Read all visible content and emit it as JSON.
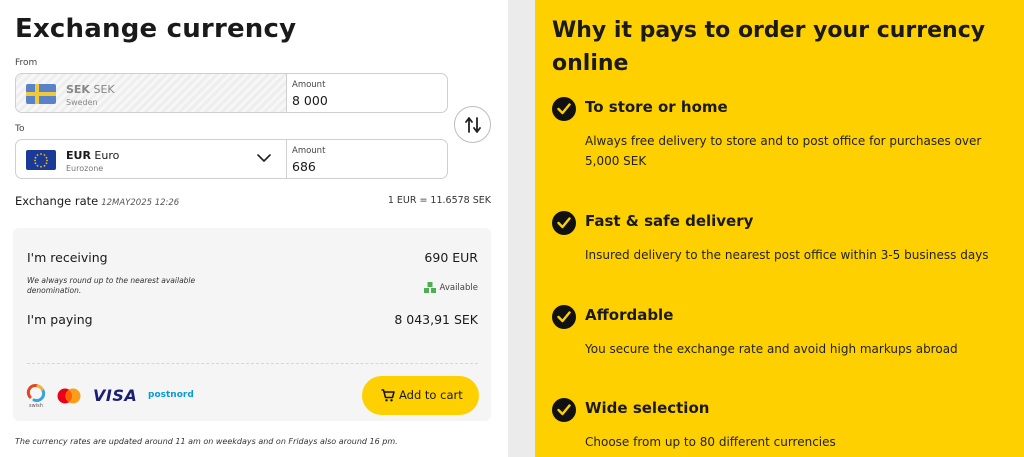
{
  "exchange": {
    "title": "Exchange currency",
    "from_label": "From",
    "to_label": "To",
    "from": {
      "code": "SEK",
      "name": "SEK",
      "country": "Sweden",
      "amount_label": "Amount",
      "amount": "8 000",
      "flag_icon": "sweden-flag-icon"
    },
    "to": {
      "code": "EUR",
      "name": "Euro",
      "country": "Eurozone",
      "amount_label": "Amount",
      "amount": "686",
      "flag_icon": "eu-flag-icon"
    },
    "swap_icon": "swap-arrows-icon",
    "rate_label": "Exchange rate",
    "rate_date": "12MAY2025 12:26",
    "rate_value": "1 EUR = 11.6578 SEK"
  },
  "summary": {
    "receiving_label": "I'm receiving",
    "receiving_value": "690 EUR",
    "round_note": "We always round up to the nearest available denomination.",
    "availability": "Available",
    "paying_label": "I'm paying",
    "paying_value": "8 043,91 SEK",
    "payment_methods": {
      "swish": "swish",
      "visa": "VISA",
      "postnord": "postnord"
    },
    "cart_button": "Add to cart"
  },
  "footnote": "The currency rates are updated around 11 am on weekdays and on Fridays also around 16 pm.",
  "benefits": {
    "title": "Why it pays to order your currency online",
    "items": [
      {
        "title": "To store or home",
        "desc": "Always free delivery to store and to post office for purchases over 5,000 SEK"
      },
      {
        "title": "Fast & safe delivery",
        "desc": "Insured delivery to the nearest post office within 3-5 business days"
      },
      {
        "title": "Affordable",
        "desc": "You secure the exchange rate and avoid high markups abroad"
      },
      {
        "title": "Wide selection",
        "desc": "Choose from up to 80 different currencies"
      }
    ]
  },
  "colors": {
    "accent": "#ffd000",
    "text": "#1a1a1a",
    "panel": "#f5f5f5",
    "available_green": "#4caf50"
  }
}
